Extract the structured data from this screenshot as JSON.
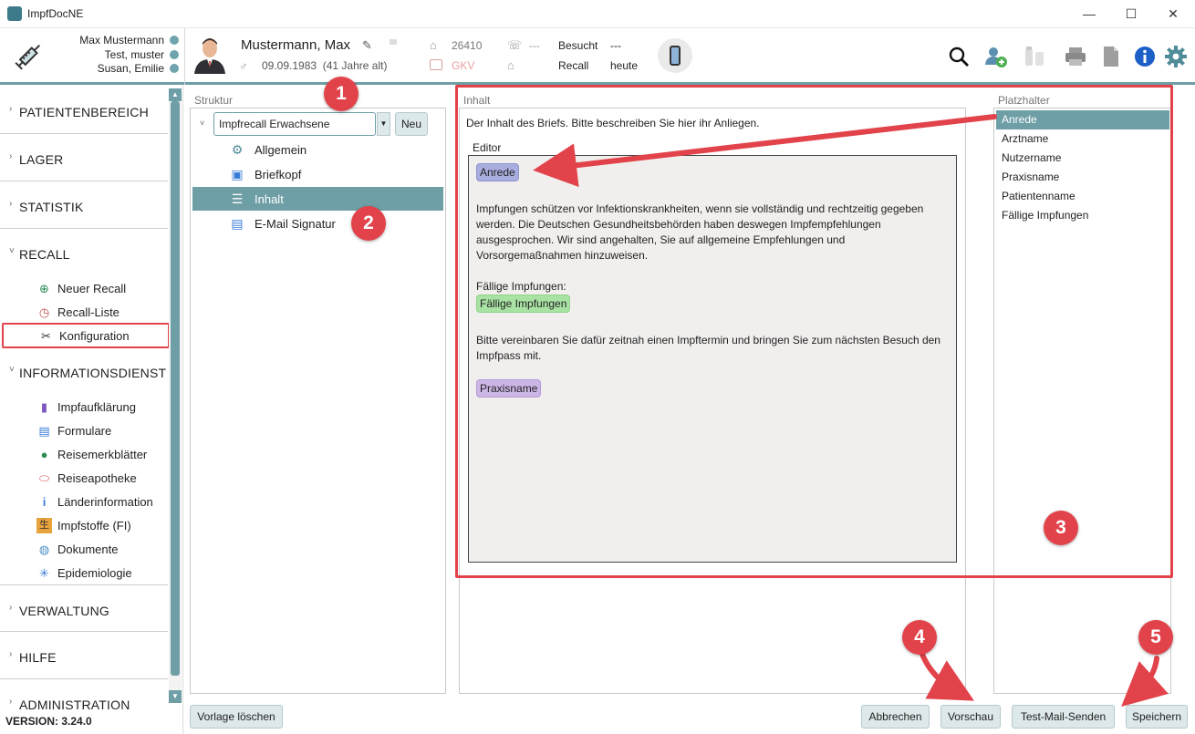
{
  "window": {
    "title": "ImpfDocNE",
    "minimize": "—",
    "maximize": "☐",
    "close": "✕"
  },
  "header": {
    "users": [
      "Max Mustermann",
      "Test, muster",
      "Susan, Emilie"
    ],
    "patient_name": "Mustermann, Max",
    "dob": "09.09.1983",
    "age": "(41 Jahre alt)",
    "patient_number": "26410",
    "insurance": "GKV",
    "phone": "---",
    "besucht_label": "Besucht",
    "besucht_value": "---",
    "recall_label": "Recall",
    "recall_value": "heute"
  },
  "sidebar": {
    "sections": {
      "patientenbereich": "PATIENTENBEREICH",
      "lager": "LAGER",
      "statistik": "STATISTIK",
      "recall": "RECALL",
      "informationsdienst": "INFORMATIONSDIENST",
      "verwaltung": "VERWALTUNG",
      "hilfe": "HILFE",
      "administration": "ADMINISTRATION"
    },
    "recall_items": [
      "Neuer Recall",
      "Recall-Liste",
      "Konfiguration"
    ],
    "info_items": [
      "Impfaufklärung",
      "Formulare",
      "Reisemerkblätter",
      "Reiseapotheke",
      "Länderinformation",
      "Impfstoffe (FI)",
      "Dokumente",
      "Epidemiologie"
    ],
    "version": "VERSION: 3.24.0"
  },
  "struktur": {
    "label": "Struktur",
    "template": "Impfrecall Erwachsene",
    "new_button": "Neu",
    "nodes": [
      "Allgemein",
      "Briefkopf",
      "Inhalt",
      "E-Mail Signatur"
    ],
    "selected": "Inhalt"
  },
  "inhalt": {
    "label": "Inhalt",
    "description": "Der Inhalt des Briefs. Bitte beschreiben Sie hier ihr Anliegen.",
    "editor_label": "Editor",
    "chip_salutation": "Anrede",
    "paragraph1": "Impfungen schützen vor Infektionskrankheiten, wenn sie vollständig und rechtzeitig gegeben werden. Die Deutschen Gesundheitsbehörden haben deswegen Impfempfehlungen ausgesprochen. Wir sind angehalten, Sie auf allgemeine Empfehlungen und Vorsorgemaßnahmen hinzuweisen.",
    "due_label": "Fällige Impfungen:",
    "chip_due": "Fällige Impfungen",
    "paragraph2": "Bitte vereinbaren Sie dafür zeitnah einen Impftermin und bringen Sie zum nächsten Besuch den Impfpass mit.",
    "chip_practice": "Praxisname"
  },
  "platzhalter": {
    "label": "Platzhalter",
    "items": [
      "Anrede",
      "Arztname",
      "Nutzername",
      "Praxisname",
      "Patientenname",
      "Fällige Impfungen"
    ],
    "selected": "Anrede"
  },
  "buttons": {
    "delete_template": "Vorlage löschen",
    "cancel": "Abbrechen",
    "preview": "Vorschau",
    "test_mail": "Test-Mail-Senden",
    "save": "Speichern"
  },
  "annotations": [
    "1",
    "2",
    "3",
    "4",
    "5"
  ],
  "colors": {
    "accent": "#6e9ea6",
    "annotation": "#e2434b"
  }
}
